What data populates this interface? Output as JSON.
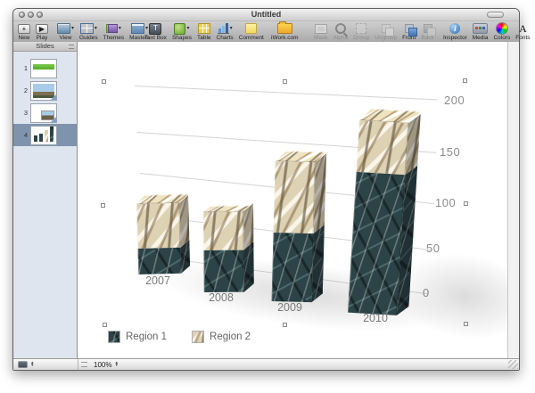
{
  "window": {
    "title": "Untitled"
  },
  "toolbar": {
    "items": [
      {
        "label": "New"
      },
      {
        "label": "Play"
      },
      {
        "label": "View"
      },
      {
        "label": "Guides"
      },
      {
        "label": "Themes"
      },
      {
        "label": "Masters"
      },
      {
        "label": "Text Box"
      },
      {
        "label": "Shapes"
      },
      {
        "label": "Table"
      },
      {
        "label": "Charts"
      },
      {
        "label": "Comment"
      },
      {
        "label": "iWork.com"
      },
      {
        "label": "Mask"
      },
      {
        "label": "Alpha"
      },
      {
        "label": "Group"
      },
      {
        "label": "Ungroup"
      },
      {
        "label": "Front"
      },
      {
        "label": "Back"
      },
      {
        "label": "Inspector"
      },
      {
        "label": "Media"
      },
      {
        "label": "Colors"
      },
      {
        "label": "Fonts"
      }
    ]
  },
  "sidebar": {
    "header": "Slides",
    "slides": [
      {
        "number": "1"
      },
      {
        "number": "2"
      },
      {
        "number": "3"
      },
      {
        "number": "4"
      }
    ]
  },
  "canvas": {
    "axis_labels": [
      "200",
      "150",
      "100",
      "50",
      "0"
    ],
    "year_labels": [
      "2007",
      "2008",
      "2009",
      "2010"
    ],
    "legend": [
      {
        "label": "Region 1"
      },
      {
        "label": "Region 2"
      }
    ]
  },
  "chart_data": {
    "type": "bar",
    "stacked": true,
    "style": "3d textured marble columns",
    "categories": [
      "2007",
      "2008",
      "2009",
      "2010"
    ],
    "series": [
      {
        "name": "Region 1",
        "texture": "dark green marble",
        "color": "#2c4347",
        "values": [
          30,
          45,
          70,
          130
        ]
      },
      {
        "name": "Region 2",
        "texture": "beige marble",
        "color": "#ded2b4",
        "values": [
          50,
          45,
          75,
          55
        ]
      }
    ],
    "value_axis": {
      "position": "right",
      "ticks": [
        0,
        50,
        100,
        150,
        200
      ],
      "range": [
        0,
        200
      ]
    },
    "grid": true,
    "legend_position": "bottom-left"
  },
  "statusbar": {
    "zoom_level": "100%"
  },
  "colors": {
    "selection_highlight": "#8093ac",
    "region1_marble": "#2c4347",
    "region2_marble": "#ded2b4",
    "axis_text": "#8c8c8c"
  }
}
